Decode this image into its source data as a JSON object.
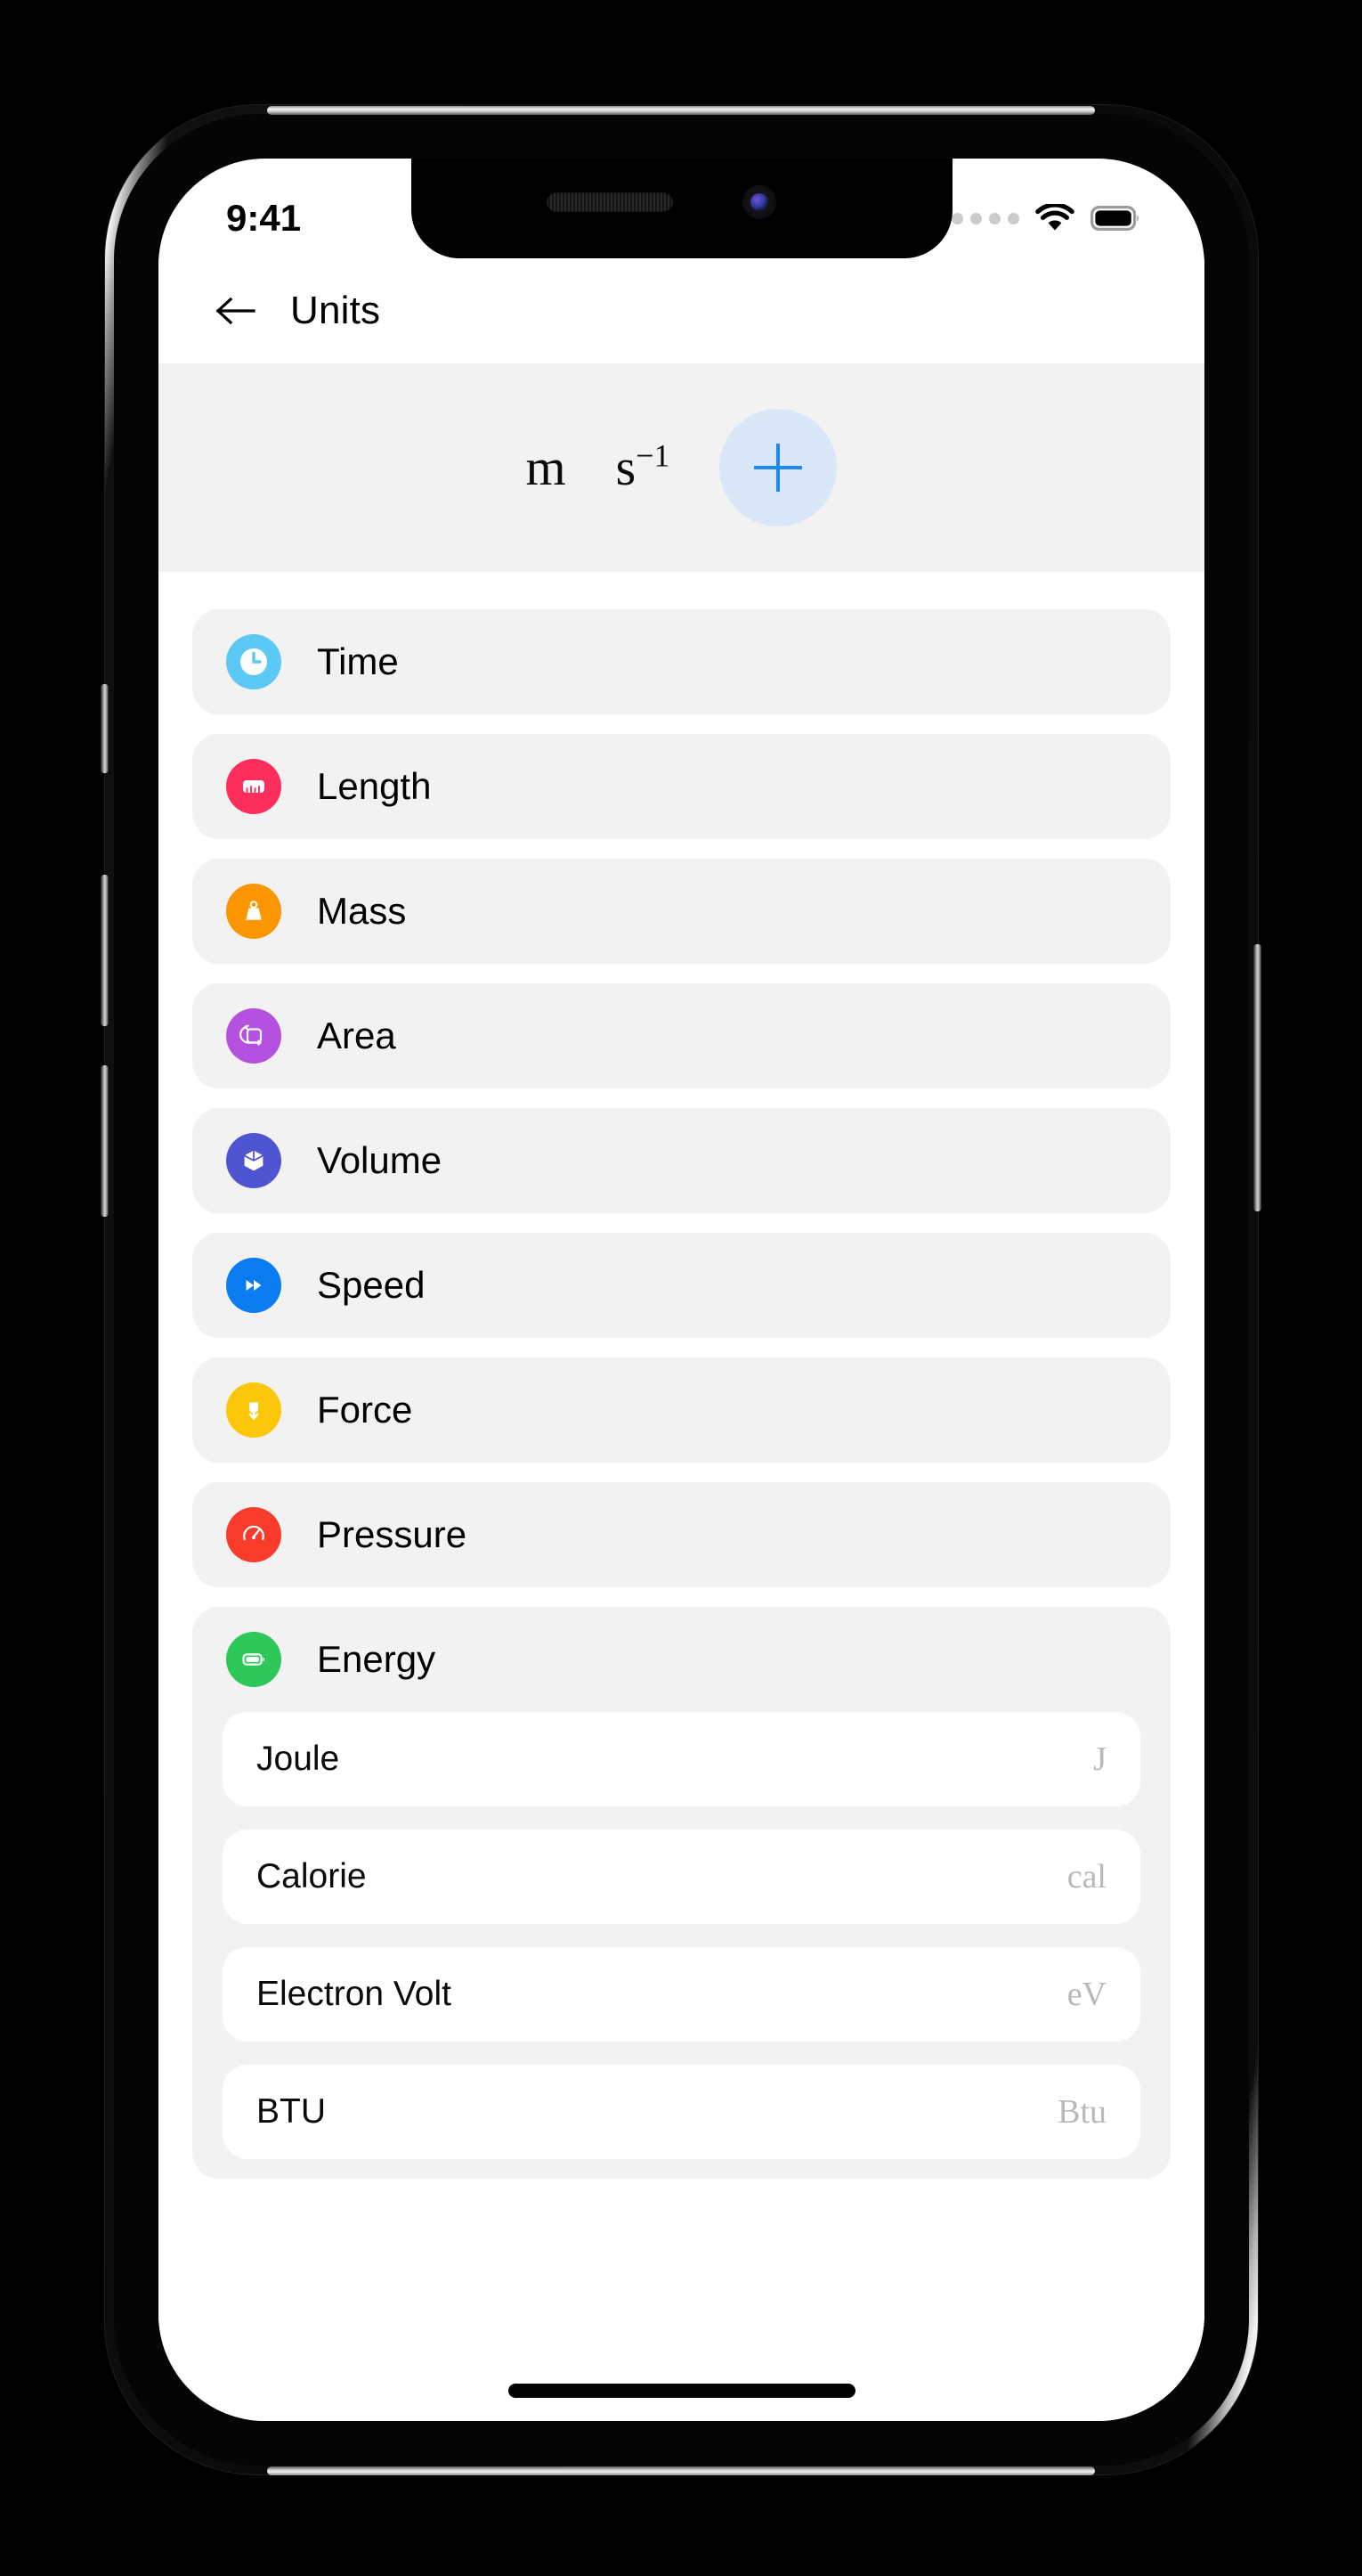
{
  "status_bar": {
    "time": "9:41",
    "signal_icon": "signal-dots-icon",
    "wifi_icon": "wifi-icon",
    "battery_icon": "battery-full-icon"
  },
  "nav": {
    "back_icon": "arrow-left-icon",
    "title": "Units"
  },
  "formula": {
    "units": [
      {
        "base": "m",
        "exponent": ""
      },
      {
        "base": "s",
        "exponent": "−1"
      }
    ],
    "add_button_icon": "plus-icon",
    "add_button_bg": "#d9e7f9",
    "add_button_accent": "#1e87f0"
  },
  "categories": [
    {
      "label": "Time",
      "icon": "clock-icon",
      "color": "#5bc8f5",
      "expanded": false
    },
    {
      "label": "Length",
      "icon": "ruler-icon",
      "color": "#fd2e5c",
      "expanded": false
    },
    {
      "label": "Mass",
      "icon": "weight-icon",
      "color": "#fb9600",
      "expanded": false
    },
    {
      "label": "Area",
      "icon": "area-rotate-icon",
      "color": "#b451e0",
      "expanded": false
    },
    {
      "label": "Volume",
      "icon": "cube-icon",
      "color": "#4f54d1",
      "expanded": false
    },
    {
      "label": "Speed",
      "icon": "fast-forward-icon",
      "color": "#0a7cf0",
      "expanded": false
    },
    {
      "label": "Force",
      "icon": "force-down-icon",
      "color": "#fcc70b",
      "expanded": false
    },
    {
      "label": "Pressure",
      "icon": "gauge-icon",
      "color": "#f83b2a",
      "expanded": false
    },
    {
      "label": "Energy",
      "icon": "battery-icon",
      "color": "#2ec75a",
      "expanded": true,
      "units": [
        {
          "name": "Joule",
          "symbol": "J"
        },
        {
          "name": "Calorie",
          "symbol": "cal"
        },
        {
          "name": "Electron Volt",
          "symbol": "eV"
        },
        {
          "name": "BTU",
          "symbol": "Btu"
        }
      ]
    }
  ]
}
